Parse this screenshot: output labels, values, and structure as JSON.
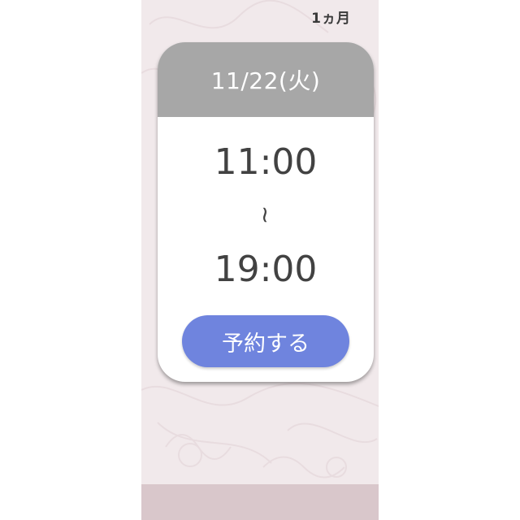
{
  "header": {
    "period_label": "1ヵ月"
  },
  "card": {
    "date": "11/22(火)",
    "start_time": "11:00",
    "separator": "~",
    "end_time": "19:00",
    "reserve_label": "予約する"
  },
  "colors": {
    "page_bg": "#f1e9eb",
    "header_bg": "#a7a7a7",
    "button_bg": "#6f84de",
    "time_text": "#424242"
  }
}
